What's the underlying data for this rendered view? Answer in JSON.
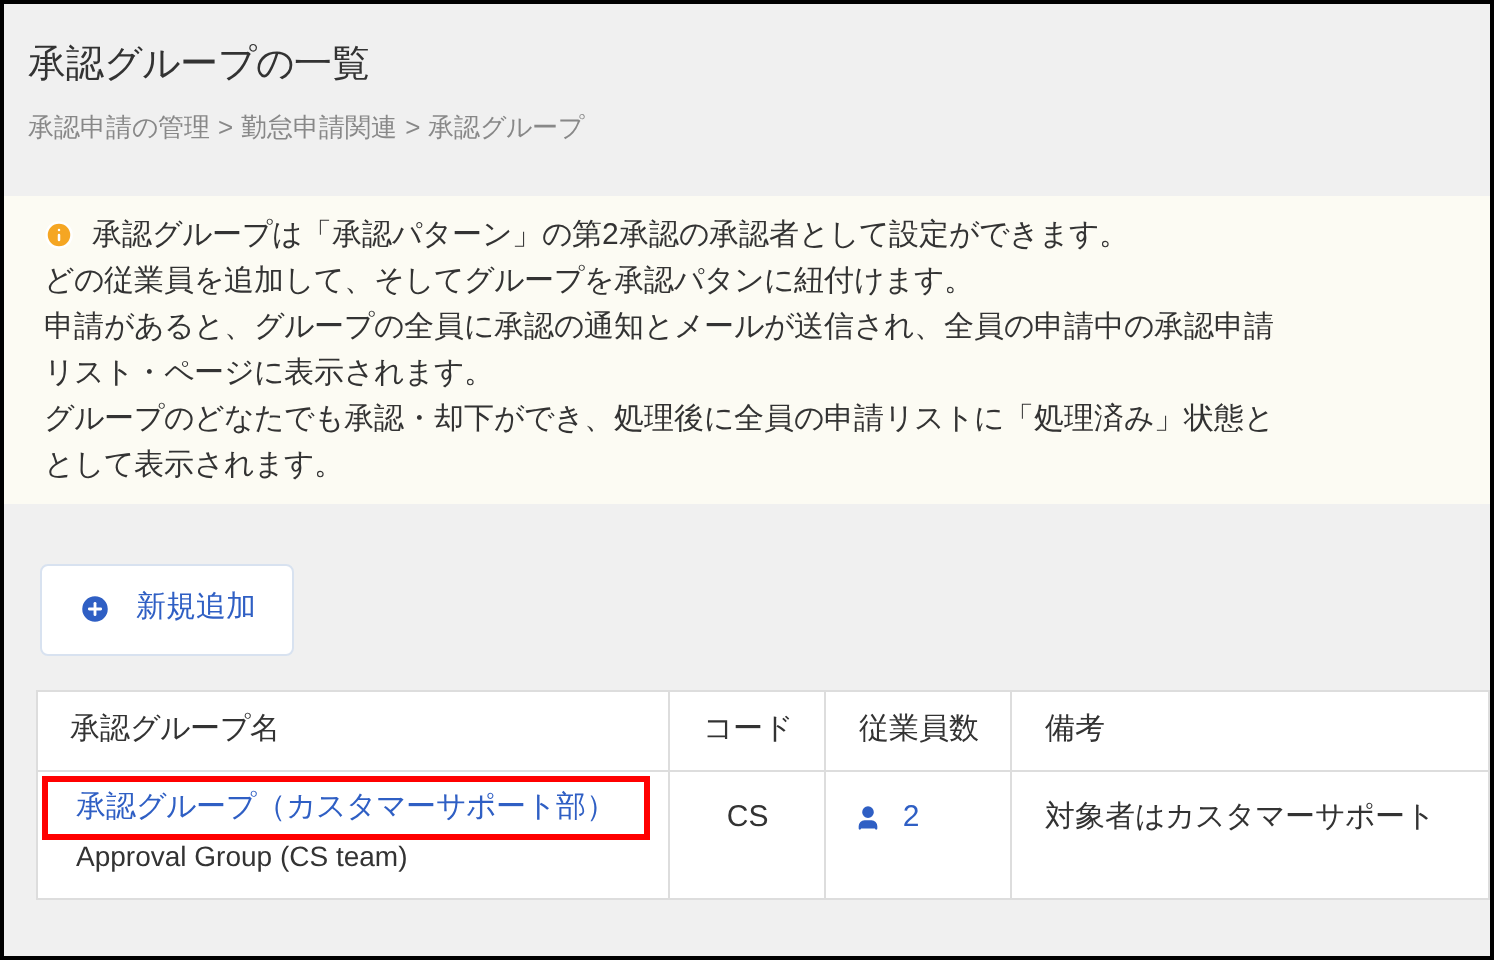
{
  "page": {
    "title": "承認グループの一覧",
    "breadcrumb": [
      "承認申請の管理",
      "勤怠申請関連",
      "承認グループ"
    ],
    "breadcrumb_separator": ">"
  },
  "notice": {
    "lines": [
      "承認グループは「承認パターン」の第2承認の承認者として設定ができます。",
      "どの従業員を追加して、そしてグループを承認パタンに紐付けます。",
      "申請があると、グループの全員に承認の通知とメールが送信され、全員の申請中の承認申請",
      "リスト・ページに表示されます。",
      "グループのどなたでも承認・却下ができ、処理後に全員の申請リストに「処理済み」状態と",
      "として表示されます。"
    ]
  },
  "add_button": {
    "label": "新規追加"
  },
  "table": {
    "columns": [
      "承認グループ名",
      "コード",
      "従業員数",
      "備考"
    ],
    "rows": [
      {
        "name": "承認グループ（カスタマーサポート部）",
        "subtitle": "Approval Group (CS team)",
        "code": "CS",
        "employees": "2",
        "remarks": "対象者はカスタマーサポート",
        "highlighted": true
      }
    ]
  }
}
